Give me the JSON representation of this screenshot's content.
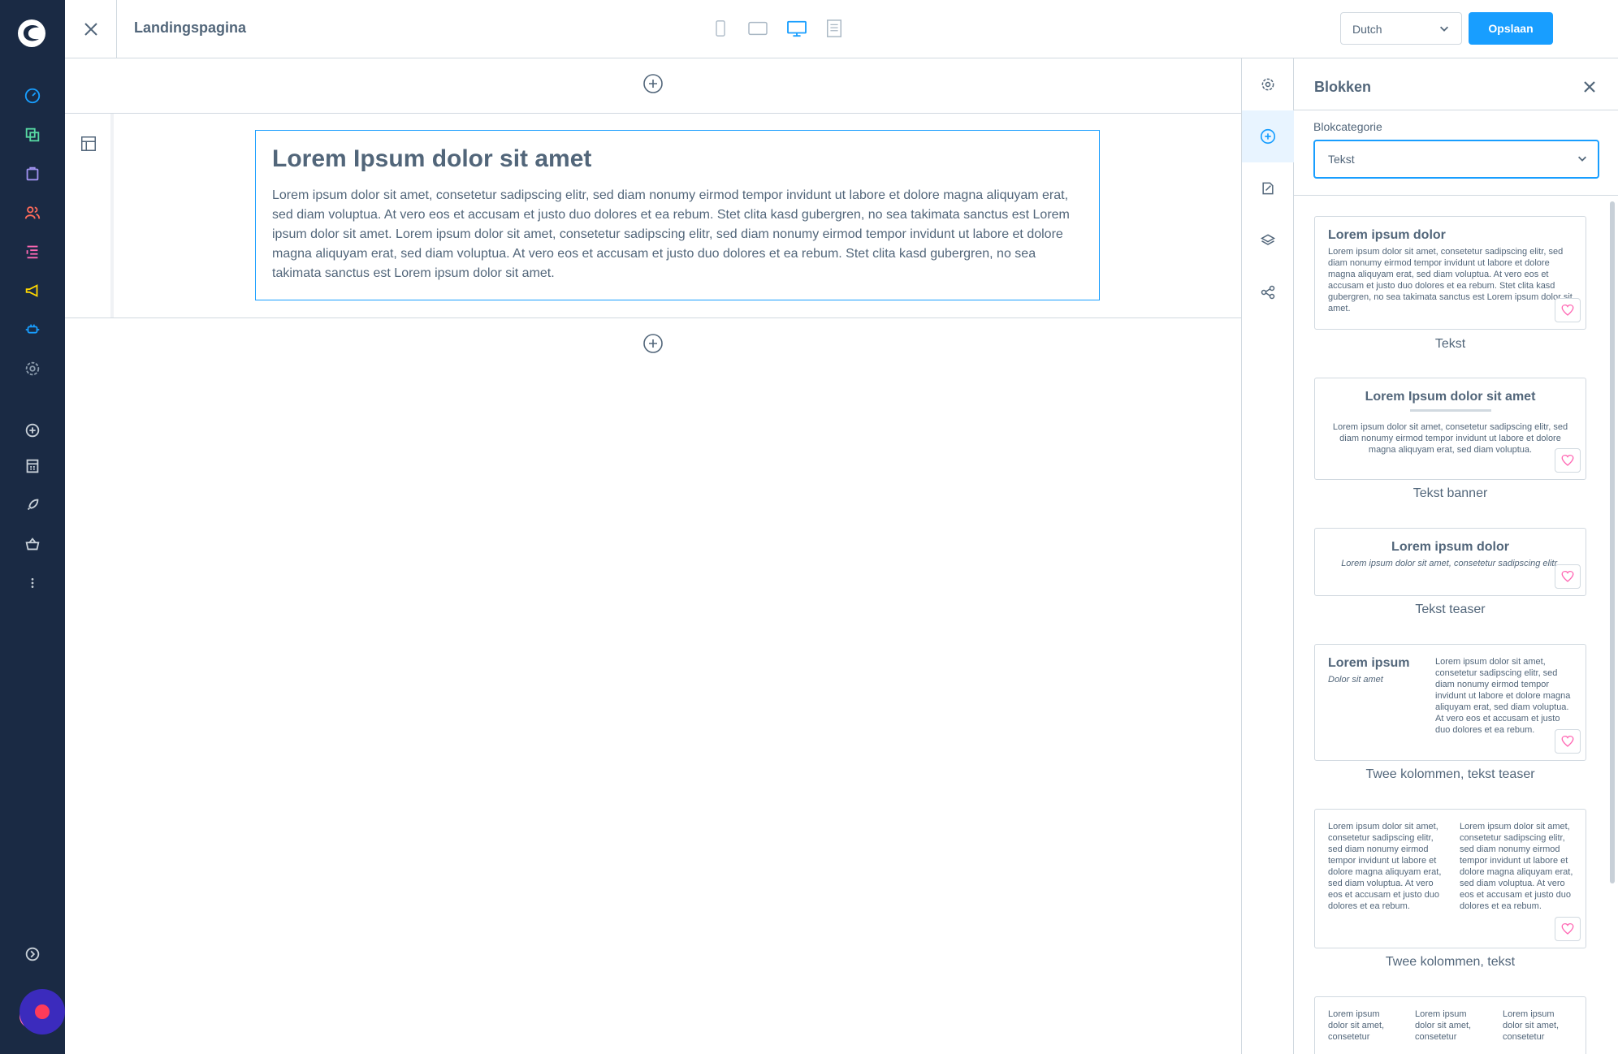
{
  "topbar": {
    "page_title": "Landingspagina",
    "language": "Dutch",
    "save_label": "Opslaan"
  },
  "canvas": {
    "block_heading": "Lorem Ipsum dolor sit amet",
    "block_text": "Lorem ipsum dolor sit amet, consetetur sadipscing elitr, sed diam nonumy eirmod tempor invidunt ut labore et dolore magna aliquyam erat, sed diam voluptua. At vero eos et accusam et justo duo dolores et ea rebum. Stet clita kasd gubergren, no sea takimata sanctus est Lorem ipsum dolor sit amet. Lorem ipsum dolor sit amet, consetetur sadipscing elitr, sed diam nonumy eirmod tempor invidunt ut labore et dolore magna aliquyam erat, sed diam voluptua. At vero eos et accusam et justo duo dolores et ea rebum. Stet clita kasd gubergren, no sea takimata sanctus est Lorem ipsum dolor sit amet."
  },
  "panel": {
    "title": "Blokken",
    "category_label": "Blokcategorie",
    "category_value": "Tekst",
    "cards": {
      "text": {
        "preview_title": "Lorem ipsum dolor",
        "preview_text": "Lorem ipsum dolor sit amet, consetetur sadipscing elitr, sed diam nonumy eirmod tempor invidunt ut labore et dolore magna aliquyam erat, sed diam voluptua. At vero eos et accusam et justo duo dolores et ea rebum. Stet clita kasd gubergren, no sea takimata sanctus est Lorem ipsum dolor sit amet.",
        "label": "Tekst"
      },
      "banner": {
        "preview_title": "Lorem Ipsum dolor sit amet",
        "preview_text": "Lorem ipsum dolor sit amet, consetetur sadipscing elitr, sed diam nonumy eirmod tempor invidunt ut labore et dolore magna aliquyam erat, sed diam voluptua.",
        "label": "Tekst banner"
      },
      "teaser": {
        "preview_title": "Lorem ipsum dolor",
        "preview_text": "Lorem ipsum dolor sit amet, consetetur sadipscing elitr.",
        "label": "Tekst teaser"
      },
      "two_col_teaser": {
        "preview_title": "Lorem ipsum",
        "preview_subtitle": "Dolor sit amet",
        "preview_text": "Lorem ipsum dolor sit amet, consetetur sadipscing elitr, sed diam nonumy eirmod tempor invidunt ut labore et dolore magna aliquyam erat, sed diam voluptua. At vero eos et accusam et justo duo dolores et ea rebum.",
        "label": "Twee kolommen, tekst teaser"
      },
      "two_col_text": {
        "preview_text_left": "Lorem ipsum dolor sit amet, consetetur sadipscing elitr, sed diam nonumy eirmod tempor invidunt ut labore et dolore magna aliquyam erat, sed diam voluptua. At vero eos et accusam et justo duo dolores et ea rebum.",
        "preview_text_right": "Lorem ipsum dolor sit amet, consetetur sadipscing elitr, sed diam nonumy eirmod tempor invidunt ut labore et dolore magna aliquyam erat, sed diam voluptua. At vero eos et accusam et justo duo dolores et ea rebum.",
        "label": "Twee kolommen, tekst"
      },
      "three_col_text": {
        "preview_text_1": "Lorem ipsum dolor sit amet, consetetur",
        "preview_text_2": "Lorem ipsum dolor sit amet, consetetur",
        "preview_text_3": "Lorem ipsum dolor sit amet, consetetur"
      }
    }
  },
  "icons": {
    "nav": [
      "dashboard-icon",
      "catalogue-icon",
      "orders-icon",
      "customers-icon",
      "content-icon",
      "marketing-icon",
      "extensions-icon",
      "settings-icon",
      "add-icon",
      "store-icon",
      "rocket-icon",
      "basket-icon",
      "more-icon",
      "collapse-icon"
    ],
    "rail": [
      "settings-icon",
      "add-block-icon",
      "edit-icon",
      "layers-icon",
      "share-icon"
    ]
  },
  "colors": {
    "accent": "#189eff",
    "nav_bg": "#1a2a44",
    "nav_green": "#57d9a3",
    "nav_orange": "#ff6b5a",
    "nav_yellow": "#ffd700",
    "nav_pink": "#ff68b4",
    "favorite": "#ff68b4",
    "text": "#52667a"
  }
}
